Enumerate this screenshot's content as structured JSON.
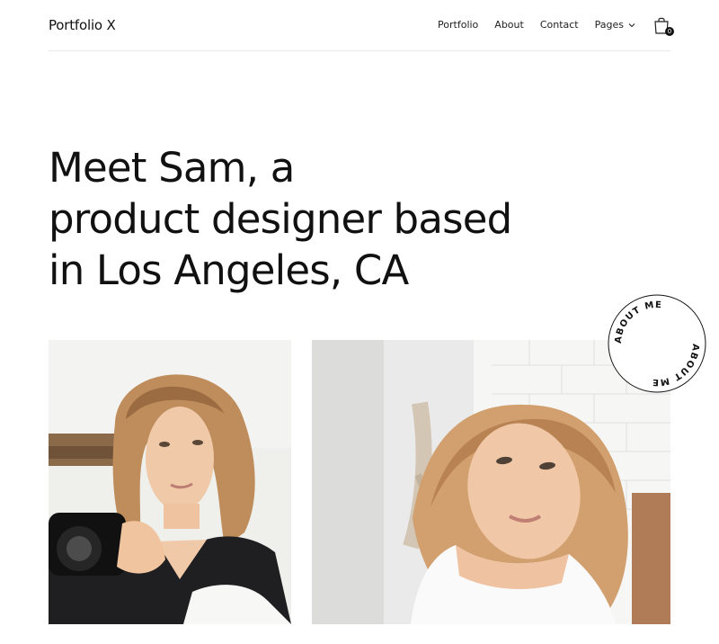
{
  "header": {
    "brand": "Portfolio X",
    "nav": [
      "Portfolio",
      "About",
      "Contact"
    ],
    "pages_label": "Pages",
    "cart_count": "0",
    "cart_icon": "shopping-bag-icon"
  },
  "hero": {
    "lines": [
      "Meet Sam, a",
      "product designer based",
      "in Los Angeles, CA"
    ]
  },
  "about_badge": {
    "text": "ABOUT ME"
  },
  "colors": {
    "text": "#111111",
    "divider": "#e8e8e8",
    "background": "#ffffff"
  }
}
